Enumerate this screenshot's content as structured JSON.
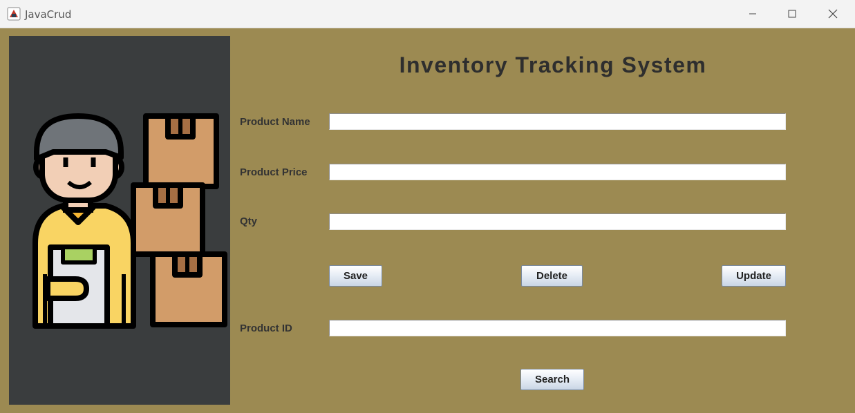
{
  "window": {
    "title": "JavaCrud"
  },
  "heading": "Inventory Tracking System",
  "form": {
    "product_name_label": "Product Name",
    "product_name_value": "",
    "product_price_label": "Product Price",
    "product_price_value": "",
    "qty_label": "Qty",
    "qty_value": "",
    "product_id_label": "Product ID",
    "product_id_value": ""
  },
  "buttons": {
    "save": "Save",
    "delete": "Delete",
    "update": "Update",
    "search": "Search"
  },
  "colors": {
    "background": "#9c8a52",
    "side_panel": "#3a3d3e",
    "titlebar": "#f3f3f3"
  }
}
